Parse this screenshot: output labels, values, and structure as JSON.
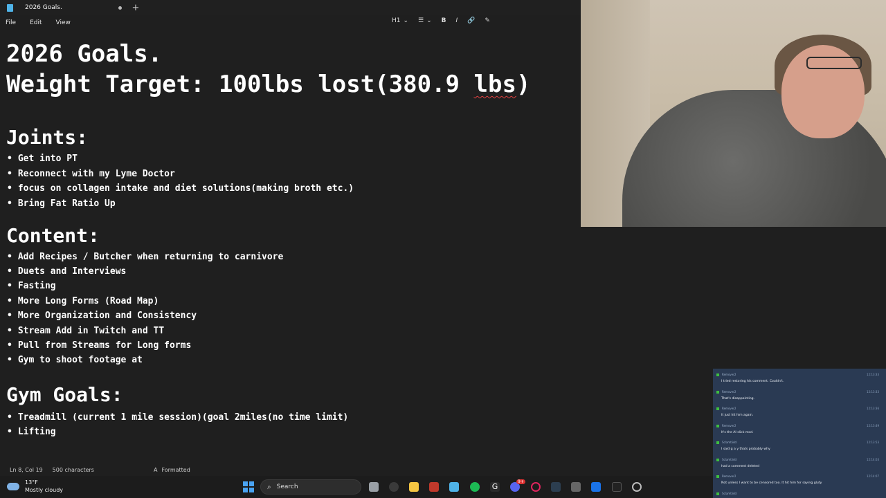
{
  "notepad": {
    "tab_title": "2026 Goals.",
    "new_tab": "+",
    "menu": [
      "File",
      "Edit",
      "View"
    ],
    "format_toolbar": [
      "H1",
      "⌄",
      "☰",
      "⌄",
      "B",
      "I",
      "🔗",
      "✎"
    ],
    "content": {
      "title": "2026 Goals.",
      "weight_line_prefix": "Weight Target: 100lbs lost(380.9 ",
      "weight_line_unit": "lbs",
      "weight_line_suffix": ")",
      "joints_heading": "Joints:",
      "joints_items": [
        "Get into PT",
        "Reconnect with my Lyme Doctor",
        "focus on collagen intake and diet solutions(making broth etc.)",
        "Bring Fat Ratio Up"
      ],
      "content_heading": "Content:",
      "content_items": [
        "Add Recipes / Butcher when returning to carnivore",
        "Duets and Interviews",
        "Fasting",
        "More Long Forms (Road Map)",
        "More Organization and Consistency",
        "Stream Add in Twitch and TT",
        "Pull from Streams for Long forms",
        "Gym to shoot footage at"
      ],
      "gym_heading": "Gym Goals:",
      "gym_items": [
        "Treadmill (current 1 mile session)(goal 2miles(no time limit)",
        "Lifting"
      ]
    },
    "status": {
      "position": "Ln 8, Col 19",
      "chars": "500 characters",
      "mode": "Formatted"
    }
  },
  "chat": {
    "messages": [
      {
        "user": "Remover2",
        "time": "12:13:33",
        "text": "I tried restoring his comment. Couldn't."
      },
      {
        "user": "Remover2",
        "time": "12:13:33",
        "text": "That's disappointing."
      },
      {
        "user": "Remover2",
        "time": "12:13:36",
        "text": "It just hit him again."
      },
      {
        "user": "Remover2",
        "time": "12:13:49",
        "text": "It's the AI slick mod."
      },
      {
        "user": "Sclamtiidd",
        "time": "12:13:53",
        "text": "I said g a y thats probably why"
      },
      {
        "user": "Sclamtiidd",
        "time": "12:14:03",
        "text": "had a comment deleted"
      },
      {
        "user": "Remover2",
        "time": "12:14:07",
        "text": "Not unless I want to be censored too. It hit him for saying gluty"
      },
      {
        "user": "Sclamtiidd",
        "time": "",
        "text": ""
      }
    ]
  },
  "taskbar": {
    "weather_temp": "13°F",
    "weather_desc": "Mostly cloudy",
    "search_label": "Search",
    "discord_badge": "9+"
  },
  "colors": {
    "editor_bg": "#1f1f1f",
    "chat_bg": "#2a3a53",
    "accent": "#4aa3f3",
    "spell_error": "#e04040"
  }
}
